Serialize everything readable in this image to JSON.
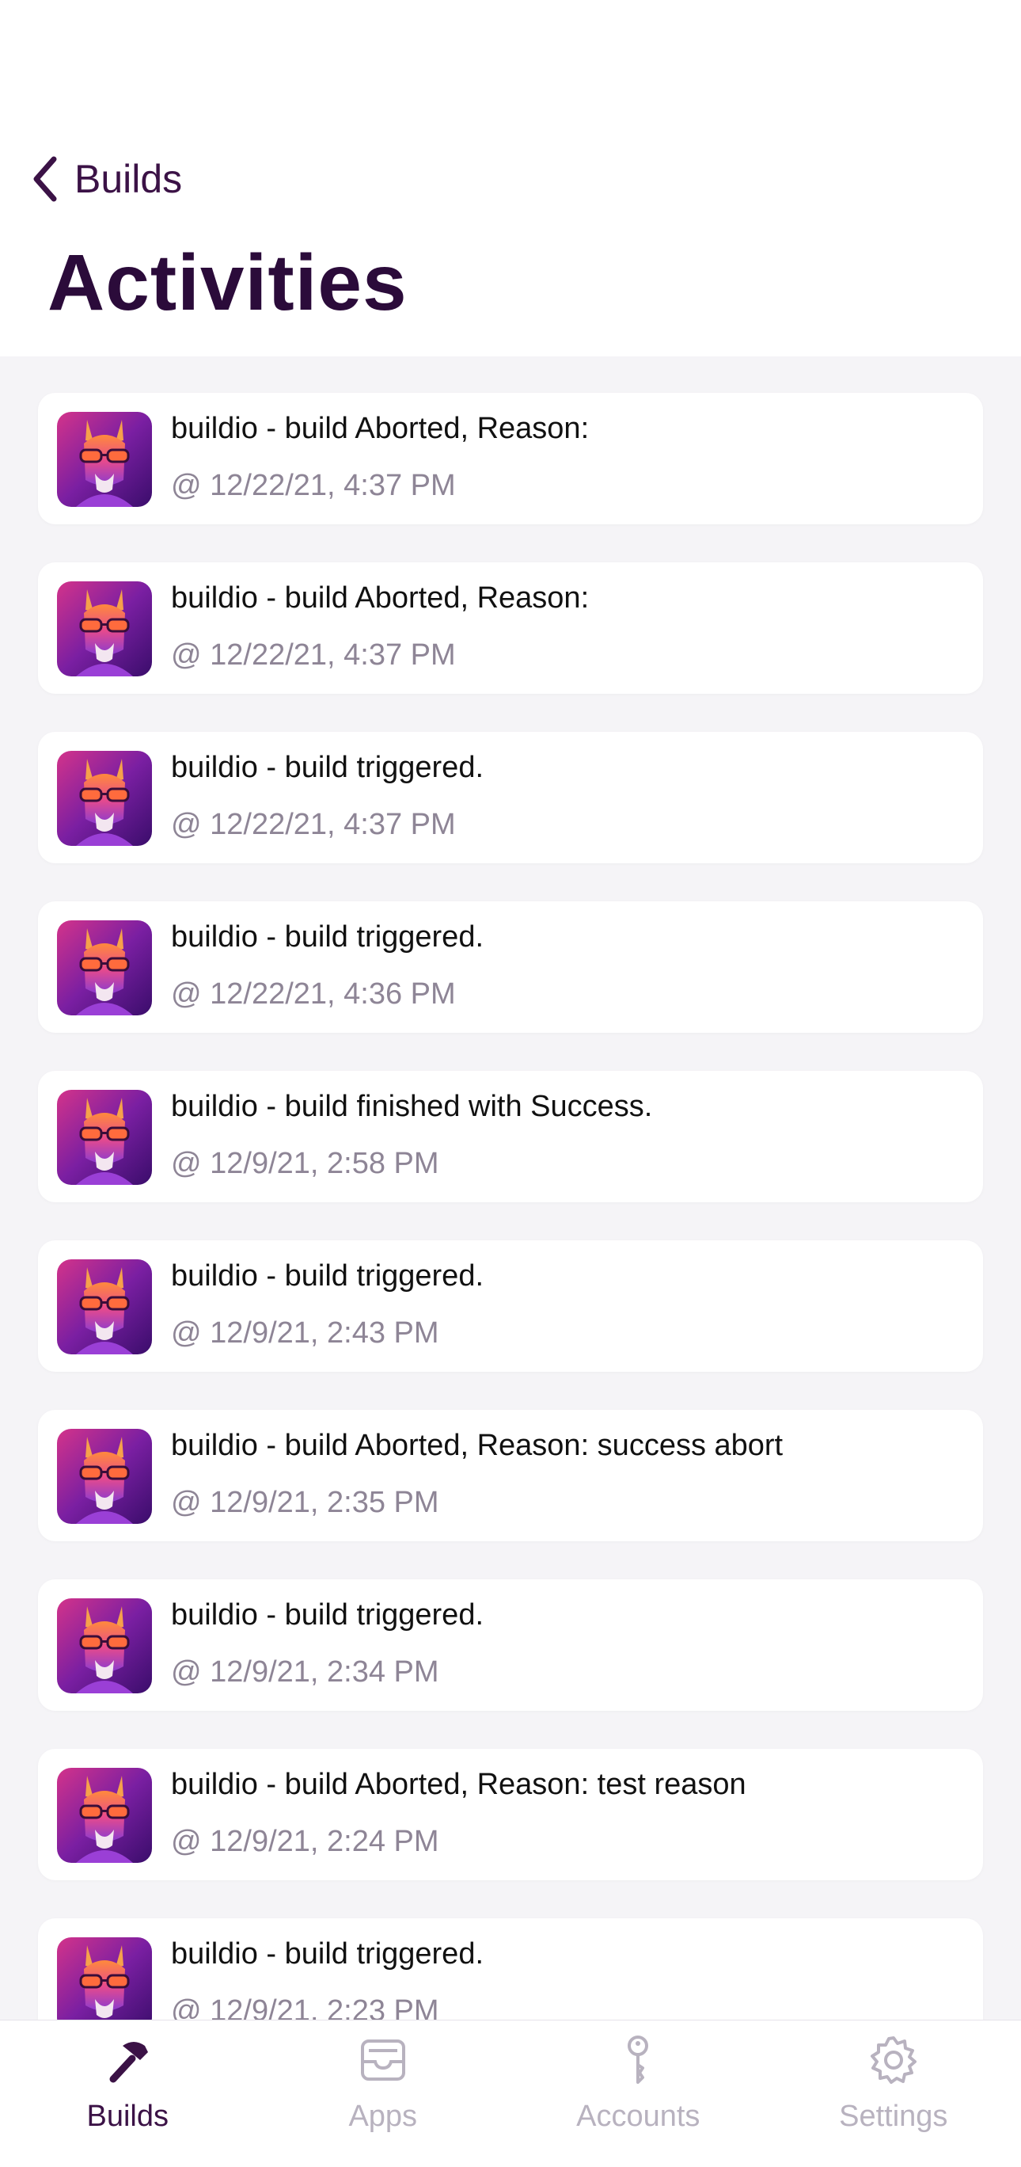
{
  "nav": {
    "back_label": "Builds",
    "title": "Activities"
  },
  "activities": [
    {
      "message": "buildio - build Aborted, Reason:",
      "time": "@ 12/22/21, 4:37 PM"
    },
    {
      "message": "buildio - build Aborted, Reason:",
      "time": "@ 12/22/21, 4:37 PM"
    },
    {
      "message": "buildio - build triggered.",
      "time": "@ 12/22/21, 4:37 PM"
    },
    {
      "message": "buildio - build triggered.",
      "time": "@ 12/22/21, 4:36 PM"
    },
    {
      "message": "buildio - build finished with Success.",
      "time": "@ 12/9/21, 2:58 PM"
    },
    {
      "message": "buildio - build triggered.",
      "time": "@ 12/9/21, 2:43 PM"
    },
    {
      "message": "buildio - build Aborted, Reason: success abort",
      "time": "@ 12/9/21, 2:35 PM"
    },
    {
      "message": "buildio - build triggered.",
      "time": "@ 12/9/21, 2:34 PM"
    },
    {
      "message": "buildio - build Aborted, Reason: test reason",
      "time": "@ 12/9/21, 2:24 PM"
    },
    {
      "message": "buildio - build triggered.",
      "time": "@ 12/9/21, 2:23 PM"
    }
  ],
  "tabbar": {
    "tabs": [
      {
        "label": "Builds",
        "icon": "hammer-icon",
        "active": true
      },
      {
        "label": "Apps",
        "icon": "inbox-icon",
        "active": false
      },
      {
        "label": "Accounts",
        "icon": "key-icon",
        "active": false
      },
      {
        "label": "Settings",
        "icon": "gear-icon",
        "active": false
      }
    ]
  },
  "colors": {
    "accent": "#3b1246",
    "inactive": "#b8b2bf",
    "background": "#f5f4f7"
  }
}
